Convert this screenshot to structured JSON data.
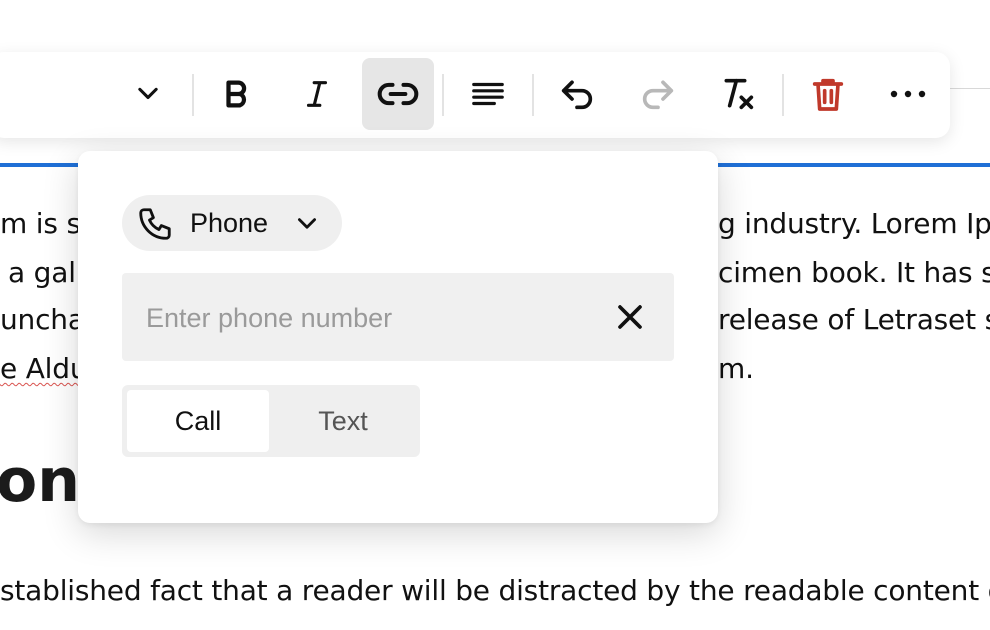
{
  "document": {
    "lines": [
      "m is sin",
      "a gall",
      "unchar",
      "e Aldu",
      "g industry. Lorem Ip",
      "cimen book. It has su",
      "release of Letraset s",
      "m."
    ],
    "heading_fragment": "on",
    "bottom_line": "stablished fact that a reader will be distracted by the readable content of"
  },
  "toolbar": {
    "icons": {
      "dropdown": "chevron-down-icon",
      "bold": "bold-icon",
      "italic": "italic-icon",
      "link": "link-icon",
      "align": "align-left-icon",
      "undo": "undo-icon",
      "redo": "redo-icon",
      "clear_format": "clear-format-icon",
      "delete": "trash-icon",
      "more": "more-icon"
    },
    "active": "link",
    "colors": {
      "delete": "#c0392b",
      "redo_disabled": "#b8b8b8"
    }
  },
  "popover": {
    "type_select": {
      "label": "Phone",
      "icon": "phone-icon"
    },
    "phone_input": {
      "placeholder": "Enter phone number",
      "value": ""
    },
    "segments": {
      "call": "Call",
      "text": "Text",
      "selected": "Call"
    }
  }
}
